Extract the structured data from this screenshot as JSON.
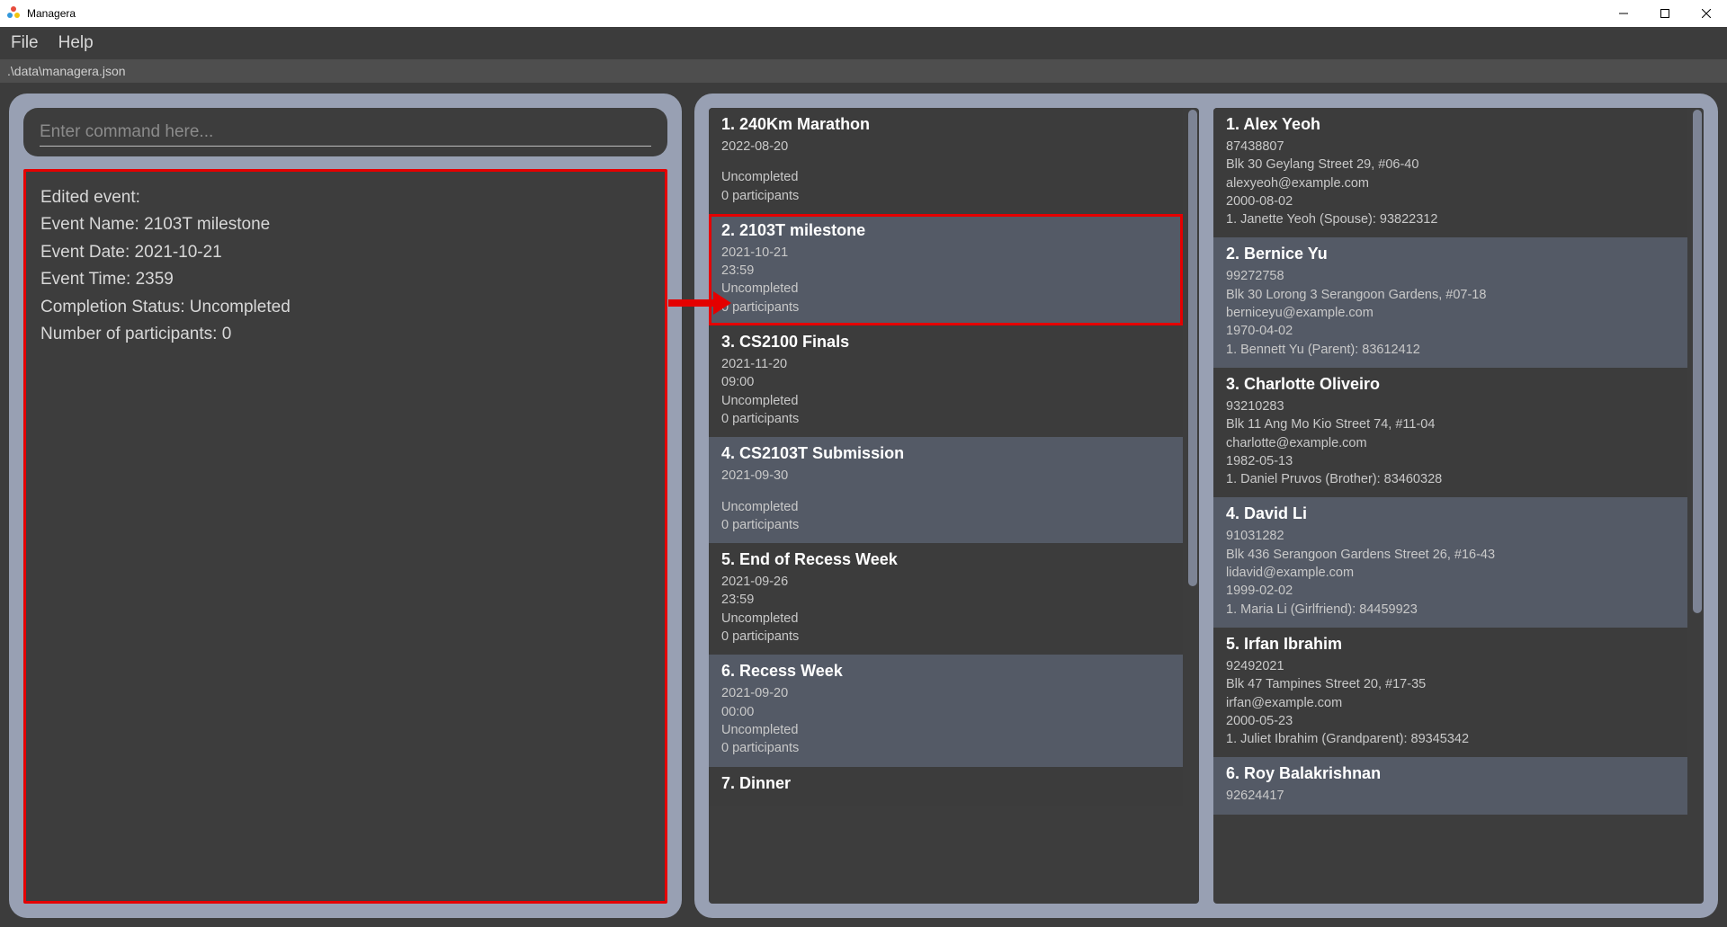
{
  "window": {
    "title": "Managera"
  },
  "menubar": {
    "file": "File",
    "help": "Help"
  },
  "pathbar": ".\\data\\managera.json",
  "command": {
    "placeholder": "Enter command here..."
  },
  "result": {
    "l1": "Edited event:",
    "l2": "Event Name: 2103T milestone",
    "l3": "Event Date: 2021-10-21",
    "l4": "Event Time: 2359",
    "l5": "Completion Status: Uncompleted",
    "l6": "Number of participants: 0"
  },
  "events": [
    {
      "idx": "1.",
      "name": "240Km Marathon",
      "date": "2022-08-20",
      "time": "",
      "status": "Uncompleted",
      "participants": "0 participants",
      "highlight": false,
      "alt": false
    },
    {
      "idx": "2.",
      "name": "2103T milestone",
      "date": "2021-10-21",
      "time": "23:59",
      "status": "Uncompleted",
      "participants": "0 participants",
      "highlight": true,
      "alt": true
    },
    {
      "idx": "3.",
      "name": "CS2100 Finals",
      "date": "2021-11-20",
      "time": "09:00",
      "status": "Uncompleted",
      "participants": "0 participants",
      "highlight": false,
      "alt": false
    },
    {
      "idx": "4.",
      "name": "CS2103T Submission",
      "date": "2021-09-30",
      "time": "",
      "status": "Uncompleted",
      "participants": "0 participants",
      "highlight": false,
      "alt": true
    },
    {
      "idx": "5.",
      "name": "End of Recess Week",
      "date": "2021-09-26",
      "time": "23:59",
      "status": "Uncompleted",
      "participants": "0 participants",
      "highlight": false,
      "alt": false
    },
    {
      "idx": "6.",
      "name": "Recess Week",
      "date": "2021-09-20",
      "time": "00:00",
      "status": "Uncompleted",
      "participants": "0 participants",
      "highlight": false,
      "alt": true
    },
    {
      "idx": "7.",
      "name": "Dinner",
      "date": "",
      "time": "",
      "status": "",
      "participants": "",
      "highlight": false,
      "alt": false
    }
  ],
  "persons": [
    {
      "idx": "1.",
      "name": "Alex Yeoh",
      "phone": "87438807",
      "address": "Blk 30 Geylang Street 29, #06-40",
      "email": "alexyeoh@example.com",
      "dob": "2000-08-02",
      "nok": "1. Janette Yeoh (Spouse): 93822312",
      "alt": false
    },
    {
      "idx": "2.",
      "name": "Bernice Yu",
      "phone": "99272758",
      "address": "Blk 30 Lorong 3 Serangoon Gardens, #07-18",
      "email": "berniceyu@example.com",
      "dob": "1970-04-02",
      "nok": "1. Bennett Yu (Parent): 83612412",
      "alt": true
    },
    {
      "idx": "3.",
      "name": "Charlotte Oliveiro",
      "phone": "93210283",
      "address": "Blk 11 Ang Mo Kio Street 74, #11-04",
      "email": "charlotte@example.com",
      "dob": "1982-05-13",
      "nok": "1. Daniel Pruvos (Brother): 83460328",
      "alt": false
    },
    {
      "idx": "4.",
      "name": "David Li",
      "phone": "91031282",
      "address": "Blk 436 Serangoon Gardens Street 26, #16-43",
      "email": "lidavid@example.com",
      "dob": "1999-02-02",
      "nok": "1. Maria Li (Girlfriend): 84459923",
      "alt": true
    },
    {
      "idx": "5.",
      "name": "Irfan Ibrahim",
      "phone": "92492021",
      "address": "Blk 47 Tampines Street 20, #17-35",
      "email": "irfan@example.com",
      "dob": "2000-05-23",
      "nok": "1. Juliet Ibrahim (Grandparent): 89345342",
      "alt": false
    },
    {
      "idx": "6.",
      "name": "Roy Balakrishnan",
      "phone": "92624417",
      "address": "",
      "email": "",
      "dob": "",
      "nok": "",
      "alt": true
    }
  ]
}
